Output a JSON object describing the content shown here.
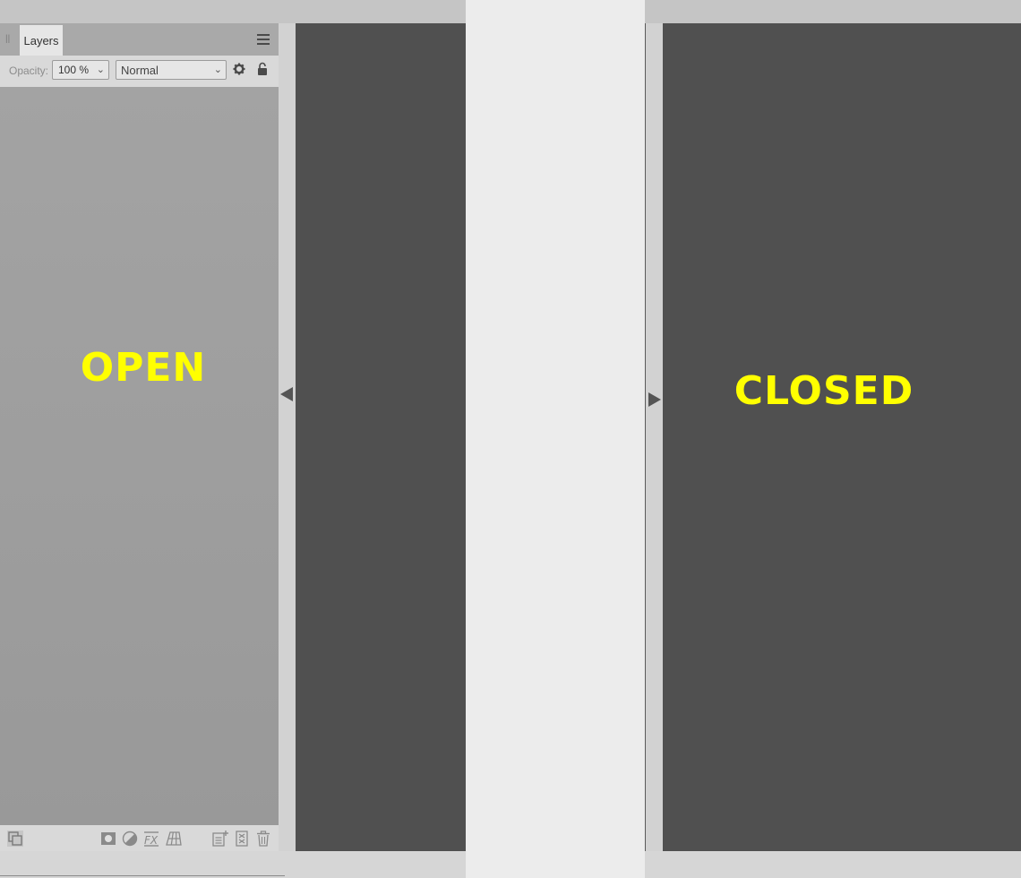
{
  "open_label": "OPEN",
  "closed_label": "CLOSED",
  "panel": {
    "tab_label": "Layers",
    "opacity_label": "Opacity:",
    "opacity_value": "100 %",
    "blend_mode": "Normal"
  },
  "icons": {
    "top": [
      "grip-icon",
      "hamburger-menu-icon",
      "gear-icon",
      "lock-icon"
    ],
    "bottom": [
      "layers-stack-icon",
      "mask-icon",
      "adjustment-icon",
      "fx-icon",
      "perspective-grid-icon",
      "add-layer-icon",
      "group-layer-icon",
      "trash-icon"
    ],
    "gutter": [
      "collapse-arrow-icon",
      "expand-arrow-icon"
    ]
  },
  "colors": {
    "label_yellow": "#ffff00",
    "canvas_dark": "#505050",
    "panel_gray": "#d9d9d9",
    "layers_bg": "#a3a3a3"
  }
}
